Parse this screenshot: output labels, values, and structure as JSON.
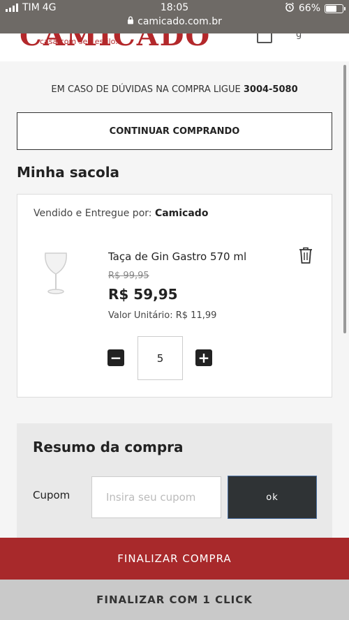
{
  "status_bar": {
    "carrier": "TIM",
    "network": "4G",
    "time": "18:05",
    "battery": "66%",
    "battery_level": 0.66,
    "url": "camicado.com.br"
  },
  "header": {
    "logo_text": "CAMICADO",
    "tagline": "casa com seu estilo.",
    "partial_text": "g"
  },
  "help": {
    "text": "EM CASO DE DÚVIDAS NA COMPRA LIGUE",
    "phone": "3004-5080"
  },
  "continue_button": "CONTINUAR COMPRANDO",
  "cart": {
    "title": "Minha sacola",
    "seller_label": "Vendido e Entregue por:",
    "seller_name": "Camicado",
    "item": {
      "name": "Taça de Gin Gastro 570 ml",
      "old_price": "R$ 99,95",
      "price": "R$ 59,95",
      "unit_price": "Valor Unitário: R$ 11,99",
      "quantity": "5"
    }
  },
  "summary": {
    "title": "Resumo da compra",
    "coupon_label": "Cupom",
    "coupon_placeholder": "Insira seu cupom",
    "coupon_value": "",
    "ok_label": "ok"
  },
  "buttons": {
    "finalize": "FINALIZAR COMPRA",
    "one_click": "FINALIZAR COM 1 CLICK"
  },
  "colors": {
    "brand_red": "#a8292b",
    "dark_button": "#2f3335",
    "one_click_bg": "#c9c9c9"
  },
  "icons": [
    "signal-icon",
    "alarm-icon",
    "battery-icon",
    "lock-icon",
    "bag-icon",
    "trash-icon",
    "minus-icon",
    "plus-icon",
    "glass-icon"
  ]
}
